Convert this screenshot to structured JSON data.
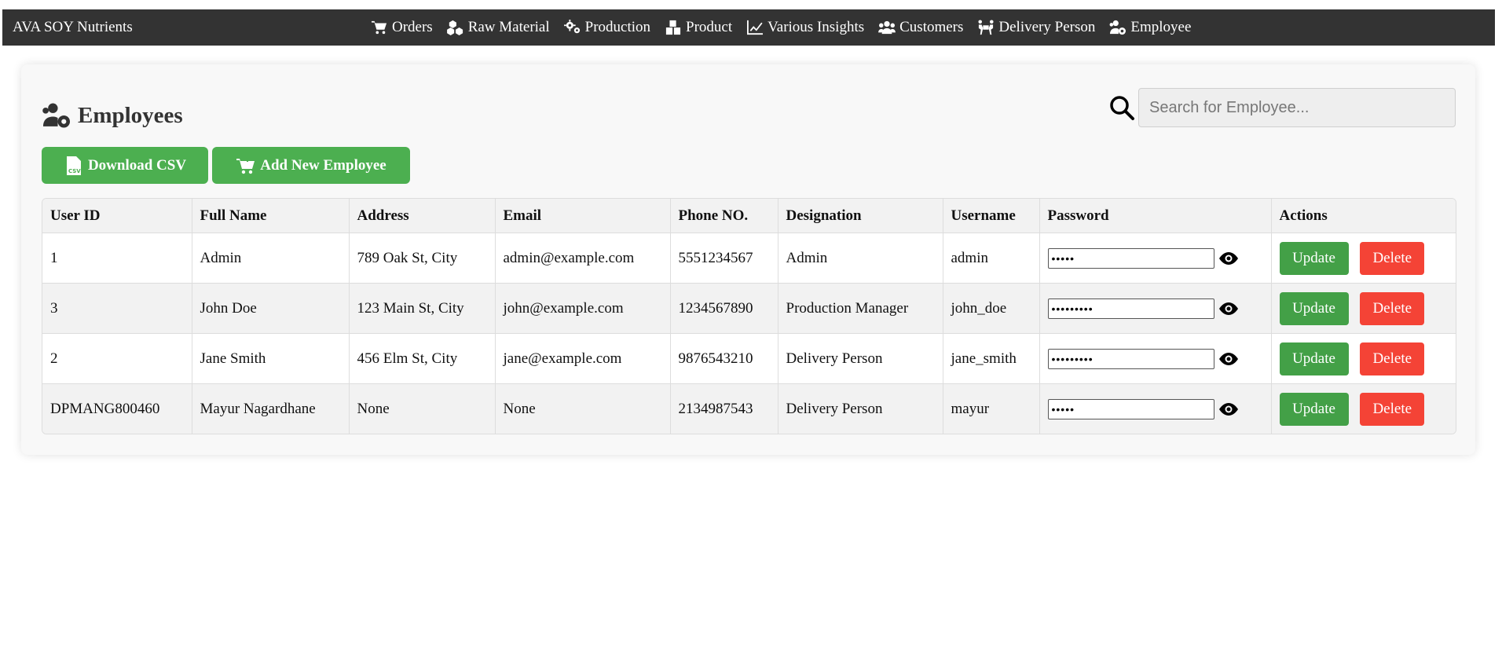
{
  "brand": "AVA SOY Nutrients",
  "nav": [
    {
      "label": "Orders",
      "icon": "cart-icon"
    },
    {
      "label": "Raw Material",
      "icon": "cubes-icon"
    },
    {
      "label": "Production",
      "icon": "gears-icon"
    },
    {
      "label": "Product",
      "icon": "boxes-icon"
    },
    {
      "label": "Various Insights",
      "icon": "line-chart-icon"
    },
    {
      "label": "Customers",
      "icon": "users-icon"
    },
    {
      "label": "Delivery Person",
      "icon": "people-carry-icon"
    },
    {
      "label": "Employee",
      "icon": "users-gear-icon"
    }
  ],
  "page": {
    "title": "Employees",
    "search_placeholder": "Search for Employee...",
    "download_csv_label": "Download CSV",
    "add_employee_label": "Add New Employee"
  },
  "table": {
    "headers": [
      "User ID",
      "Full Name",
      "Address",
      "Email",
      "Phone NO.",
      "Designation",
      "Username",
      "Password",
      "Actions"
    ],
    "rows": [
      {
        "user_id": "1",
        "full_name": "Admin",
        "address": "789 Oak St, City",
        "email": "admin@example.com",
        "phone": "5551234567",
        "designation": "Admin",
        "username": "admin",
        "password": "•••••"
      },
      {
        "user_id": "3",
        "full_name": "John Doe",
        "address": "123 Main St, City",
        "email": "john@example.com",
        "phone": "1234567890",
        "designation": "Production Manager",
        "username": "john_doe",
        "password": "•••••••••"
      },
      {
        "user_id": "2",
        "full_name": "Jane Smith",
        "address": "456 Elm St, City",
        "email": "jane@example.com",
        "phone": "9876543210",
        "designation": "Delivery Person",
        "username": "jane_smith",
        "password": "•••••••••"
      },
      {
        "user_id": "DPMANG800460",
        "full_name": "Mayur Nagardhane",
        "address": "None",
        "email": "None",
        "phone": "2134987543",
        "designation": "Delivery Person",
        "username": "mayur",
        "password": "•••••"
      }
    ],
    "update_label": "Update",
    "delete_label": "Delete"
  },
  "colors": {
    "topbar": "#333333",
    "green": "#4caf50",
    "update": "#43a047",
    "delete": "#f44336"
  }
}
